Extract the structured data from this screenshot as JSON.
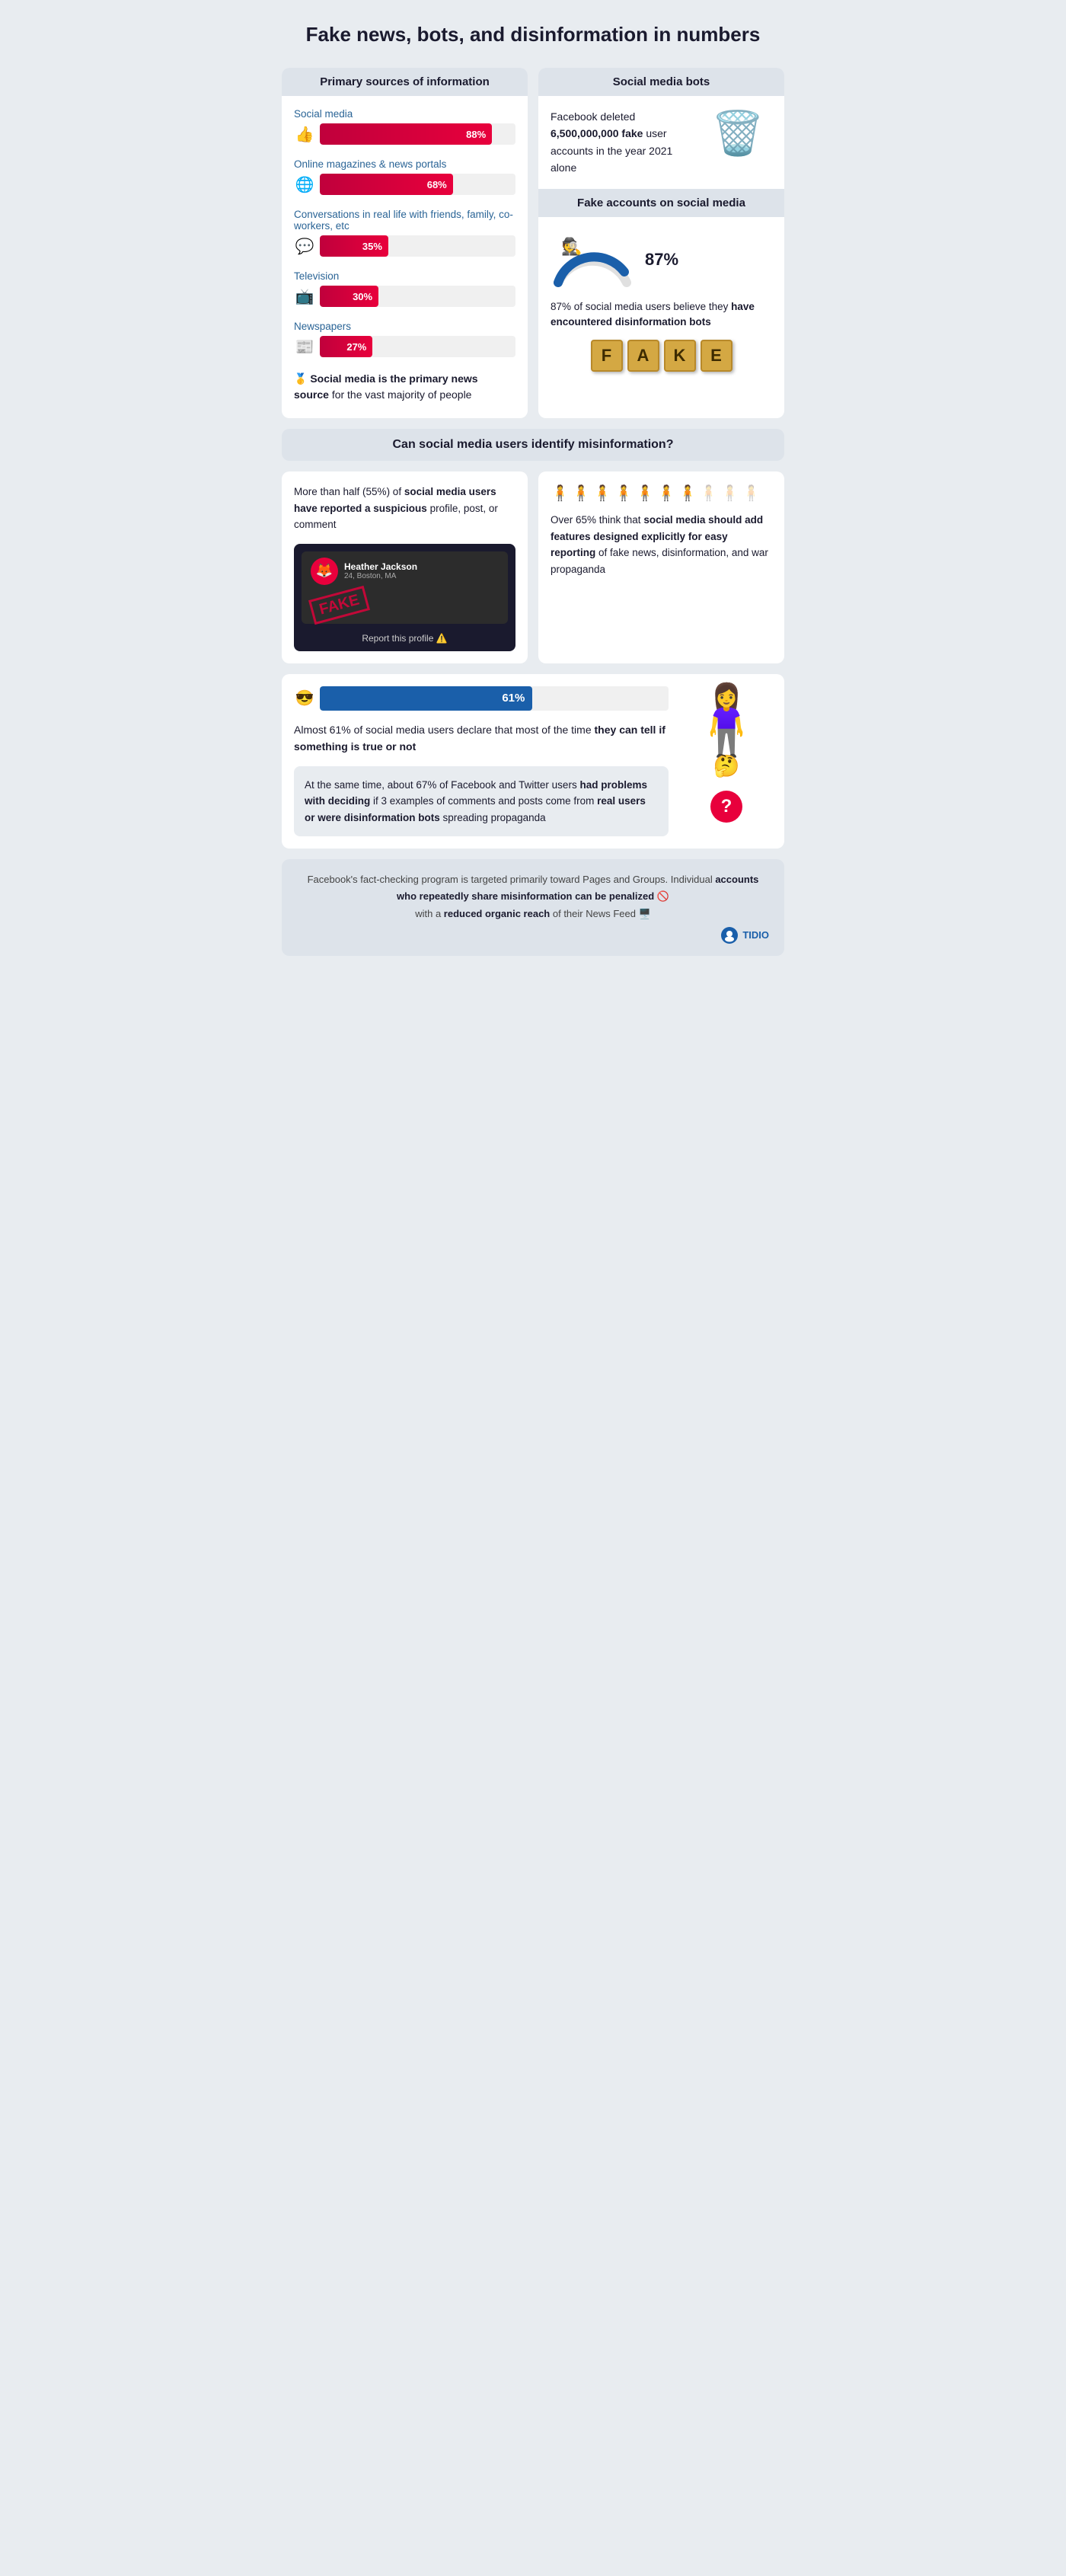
{
  "title": "Fake news, bots, and disinformation in numbers",
  "left_panel": {
    "header": "Primary sources of information",
    "bars": [
      {
        "label": "Social media",
        "icon": "👍",
        "pct": 88,
        "pct_label": "88%"
      },
      {
        "label": "Online magazines & news portals",
        "icon": "🌐",
        "pct": 68,
        "pct_label": "68%"
      },
      {
        "label": "Conversations in real life with friends, family, co-workers, etc",
        "icon": "💬",
        "pct": 35,
        "pct_label": "35%"
      },
      {
        "label": "Television",
        "icon": "🖥️",
        "pct": 30,
        "pct_label": "30%"
      },
      {
        "label": "Newspapers",
        "icon": "📰",
        "pct": 27,
        "pct_label": "27%"
      }
    ],
    "note_icon": "🥇",
    "note_text": "Social media is the primary news source for the vast majority of people"
  },
  "right_panel": {
    "bots_header": "Social media bots",
    "fb_text": "Facebook deleted 6,500,000,000 fake user accounts in the year 2021 alone",
    "fake_accounts_header": "Fake accounts on social media",
    "gauge_pct": "87%",
    "gauge_value": 87,
    "fake_accounts_text": "87% of social media users believe they have",
    "fake_accounts_text_bold": "encountered disinformation bots",
    "scrabble_letters": [
      "F",
      "A",
      "K",
      "E"
    ]
  },
  "mid_section": {
    "header": "Can social media users identify misinformation?"
  },
  "identify": {
    "left_text_normal": "More than half (55%) of",
    "left_text_bold": "social media users have reported a suspicious",
    "left_text_normal2": "profile, post, or comment",
    "right_text_normal": "Over 65% think that",
    "right_text_bold": "social media should add features designed explicitly for easy reporting",
    "right_text_normal2": "of fake news, disinformation, and war propaganda",
    "people_count": 10,
    "pink_count": 7
  },
  "bottom": {
    "bar_icon": "😎",
    "bar_pct": 61,
    "bar_pct_label": "61%",
    "bar_color": "#1a5faa",
    "almost_text": "Almost 61% of social media users declare that most of the time",
    "almost_bold": "they can tell if something is true or not",
    "gray_text_normal": "At the same time, about 67% of Facebook and Twitter users",
    "gray_text_bold1": "had problems with deciding",
    "gray_text_normal2": "if 3 examples of comments and posts come from",
    "gray_text_bold2": "real users or were disinformation bots",
    "gray_text_normal3": "spreading propaganda"
  },
  "footer": {
    "text_normal": "Facebook's fact-checking program is targeted primarily toward Pages and Groups. Individual",
    "text_bold": "accounts who repeatedly share misinformation can be penalized",
    "text_normal2": "with a",
    "text_bold2": "reduced organic reach",
    "text_normal3": "of their News Feed",
    "icon1": "🚫",
    "icon2": "🖥️",
    "brand": "TIDIO"
  },
  "profile_mock": {
    "name": "Heather Jackson",
    "location": "24, Boston, MA",
    "report_label": "Report this profile"
  }
}
